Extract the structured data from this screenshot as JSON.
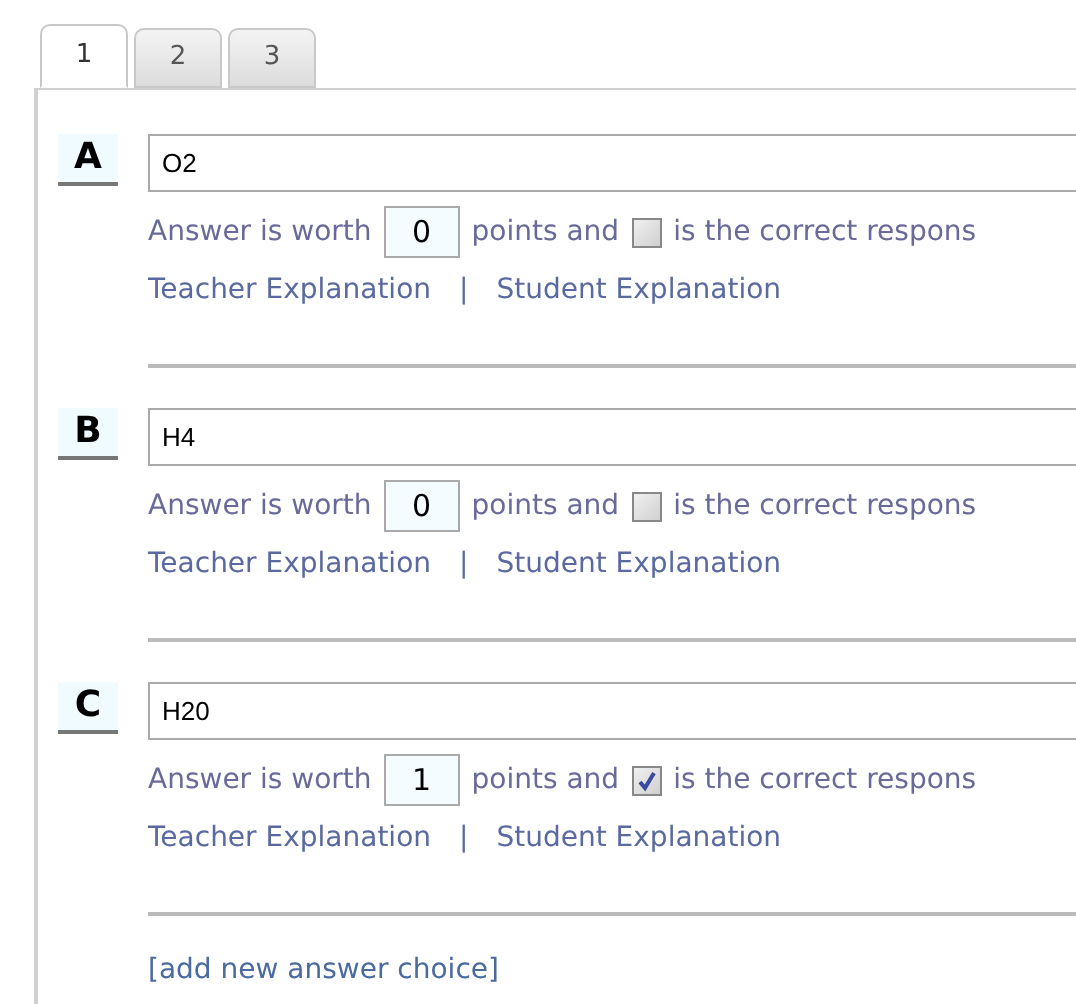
{
  "tabs": [
    {
      "label": "1",
      "selected": true
    },
    {
      "label": "2",
      "selected": false
    },
    {
      "label": "3",
      "selected": false
    }
  ],
  "answers": [
    {
      "letter": "A",
      "value": "O2",
      "worth_label": "Answer is worth",
      "points": "0",
      "points_label": "points and",
      "correct": false,
      "correct_label": "is the correct respons",
      "teacher_link": "Teacher Explanation",
      "separator": "|",
      "student_link": "Student Explanation"
    },
    {
      "letter": "B",
      "value": "H4",
      "worth_label": "Answer is worth",
      "points": "0",
      "points_label": "points and",
      "correct": false,
      "correct_label": "is the correct respons",
      "teacher_link": "Teacher Explanation",
      "separator": "|",
      "student_link": "Student Explanation"
    },
    {
      "letter": "C",
      "value": "H20",
      "worth_label": "Answer is worth",
      "points": "1",
      "points_label": "points and",
      "correct": true,
      "correct_label": "is the correct respons",
      "teacher_link": "Teacher Explanation",
      "separator": "|",
      "student_link": "Student Explanation"
    }
  ],
  "add_link": "[add new answer choice]"
}
